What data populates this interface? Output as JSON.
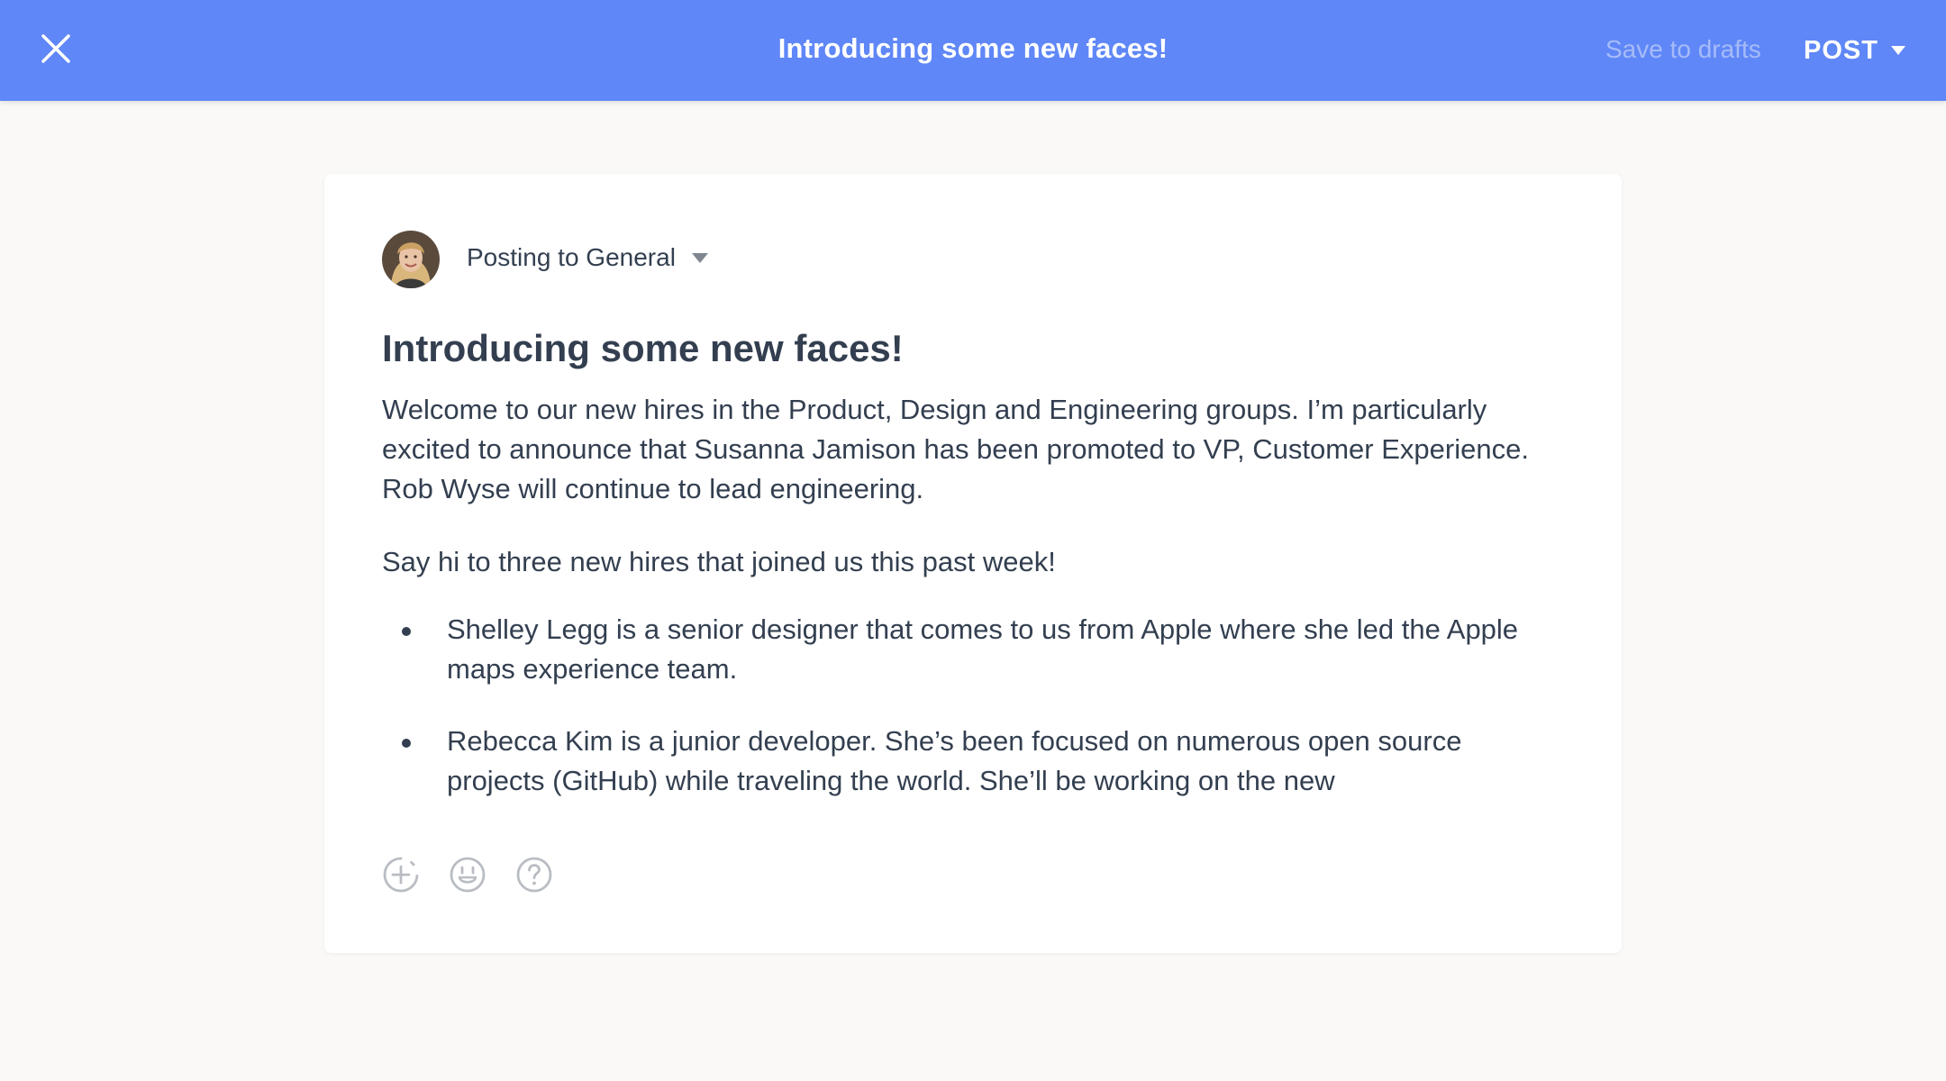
{
  "topbar": {
    "title": "Introducing some new faces!",
    "save_label": "Save to drafts",
    "post_label": "POST",
    "accent_color": "#5f87f7"
  },
  "composer": {
    "posting_to": "Posting to General",
    "title": "Introducing some new faces!",
    "paragraphs": [
      "Welcome to our new hires in the Product, Design and Engineering groups. I’m particularly excited to announce that Susanna Jamison has been promoted to VP, Customer Experience. Rob Wyse will continue to lead engineering.",
      "Say hi to three new hires that joined us this past week!"
    ],
    "bullets": [
      "Shelley Legg is a senior designer that comes to us from Apple where she led the Apple maps experience team.",
      "Rebecca Kim is a junior developer. She’s been focused on numerous open source projects (GitHub) while traveling the world. She’ll be working on the new"
    ],
    "toolbar_icons": [
      "add-attachment-icon",
      "emoji-icon",
      "help-icon"
    ]
  }
}
